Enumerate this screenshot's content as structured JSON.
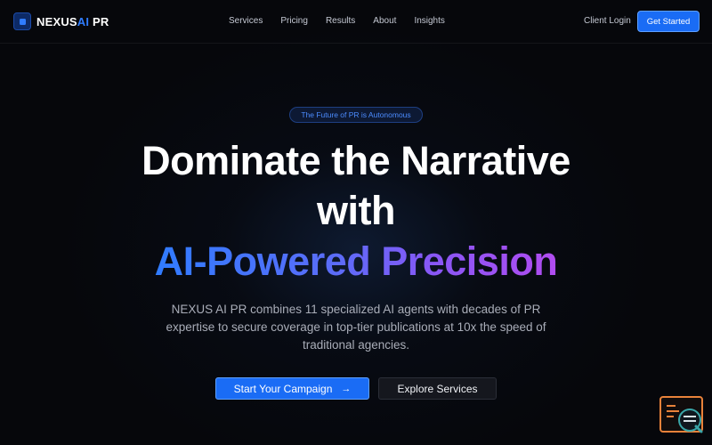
{
  "brand": {
    "name_prefix": "NEXUS",
    "name_ai": "AI",
    "name_suffix": " PR"
  },
  "nav": {
    "links": [
      "Services",
      "Pricing",
      "Results",
      "About",
      "Insights"
    ],
    "client_login": "Client Login",
    "get_started": "Get Started"
  },
  "hero": {
    "badge": "The Future of PR is Autonomous",
    "headline_line1": "Dominate the Narrative",
    "headline_line2": "with",
    "headline_line3": "AI-Powered Precision",
    "lead": "NEXUS AI PR combines 11 specialized AI agents with decades of PR expertise to secure coverage in top-tier publications at 10x the speed of traditional agencies.",
    "primary_cta": "Start Your Campaign",
    "secondary_cta": "Explore Services"
  },
  "colors": {
    "accent": "#1a6cf5",
    "gradient_start": "#2f7cff",
    "gradient_end": "#b24cf0",
    "widget": "#e8823a"
  },
  "icons": {
    "logo": "square-chip-icon",
    "cta_arrow": "arrow-right-icon",
    "widget": "terminal-search-icon"
  }
}
